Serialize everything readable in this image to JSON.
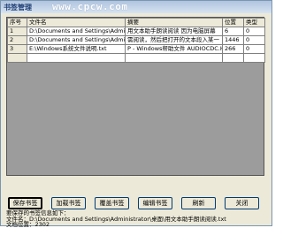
{
  "window": {
    "title": "书签管理",
    "watermark": "www.cpcw.com"
  },
  "grid": {
    "columns": [
      "序号",
      "文件名",
      "摘要",
      "位置",
      "类型"
    ],
    "rows": [
      {
        "index": "1",
        "filename": "D:\\Documents and Settings\\Administrator\\桌面\\用文本助手朗读阅读.txt",
        "summary": "用文本助手朗读阅读      因为电脑屏幕",
        "position": "6",
        "type": "0"
      },
      {
        "index": "2",
        "filename": "D:\\Documents and Settings\\Administrator\\桌面\\用文本助手朗读阅读.txt",
        "summary": "需阅读，然后把打开的文本段入某一",
        "position": "1446",
        "type": "0"
      },
      {
        "index": "3",
        "filename": "E:\\Windows系统文件说明.txt",
        "summary": "P - Windows帮助文件 AUDIOCDC.HLP - 音",
        "position": "266",
        "type": "0"
      }
    ]
  },
  "buttons": {
    "save": "保存书签",
    "load": "加载书签",
    "overwrite": "覆盖书签",
    "edit": "编辑书签",
    "refresh": "刷新",
    "close": "关闭"
  },
  "info": {
    "heading": "要保存的书签信息如下：",
    "filename_line": "文件名：D:\\Documents and Settings\\Administrator\\桌面\\用文本助手朗读阅读.txt",
    "position_line": "文档位置：2302"
  }
}
